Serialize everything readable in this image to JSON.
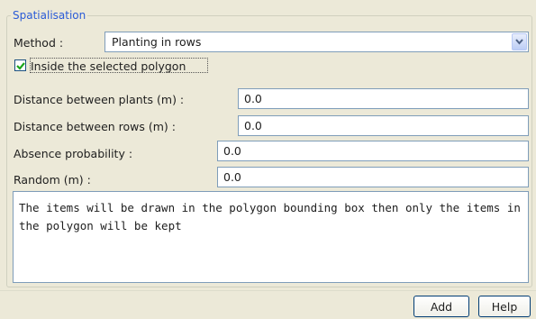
{
  "group": {
    "title": "Spatialisation"
  },
  "method": {
    "label": "Method :",
    "value": "Planting in rows"
  },
  "inside_polygon": {
    "label": "Inside the selected polygon",
    "checked": true
  },
  "fields": [
    {
      "label": "Distance between plants (m) :",
      "value": "0.0"
    },
    {
      "label": "Distance between rows (m) :",
      "value": "0.0"
    },
    {
      "label": "Absence probability :",
      "value": "0.0"
    },
    {
      "label": "Random (m) :",
      "value": "0.0"
    }
  ],
  "info_text": "The items will be drawn in the polygon bounding box then only the items in the polygon will be kept",
  "buttons": {
    "add": "Add",
    "help": "Help"
  },
  "icons": {
    "dropdown": "chevron-down-icon",
    "check": "check-icon"
  },
  "colors": {
    "legend": "#2a5bd7",
    "check": "#1aa51a",
    "border": "#7f9db9"
  }
}
